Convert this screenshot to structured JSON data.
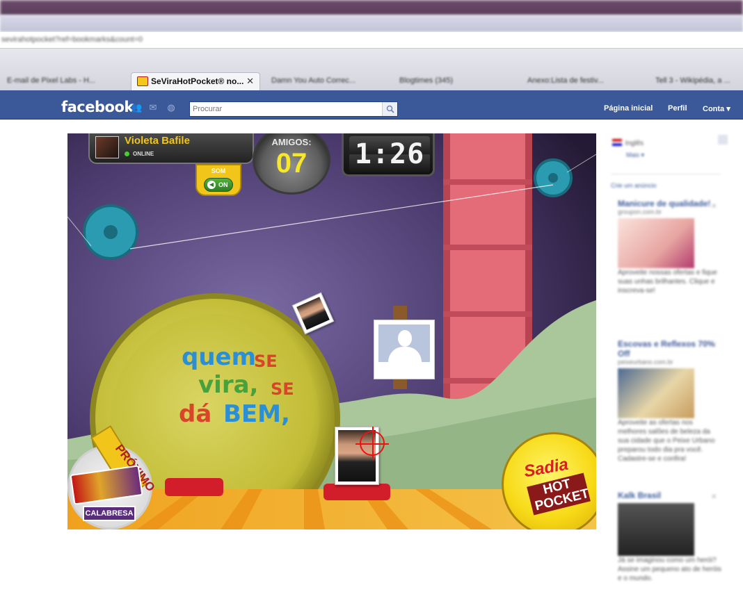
{
  "browser": {
    "address": "sevirahotpocket?ref=bookmarks&count=0",
    "tabs": [
      {
        "label": "E-mail de Pixel Labs - H..."
      },
      {
        "label": "SeViraHotPocket® no...",
        "active": true
      },
      {
        "label": "Damn You Auto Correc..."
      },
      {
        "label": "Blogtimes (345)"
      },
      {
        "label": "Anexo:Lista de festiv..."
      },
      {
        "label": "Tell 3 - Wikipédia, a ..."
      }
    ],
    "close_glyph": "✕"
  },
  "facebook": {
    "logo": "facebook",
    "search_placeholder": "Procurar",
    "nav": {
      "home": "Página inicial",
      "profile": "Perfil",
      "account": "Conta"
    },
    "colors": {
      "bar": "#3b5998"
    }
  },
  "game": {
    "player": {
      "name": "Violeta Bafile",
      "status": "ONLINE"
    },
    "sound": {
      "label": "SOM",
      "state": "ON"
    },
    "friends": {
      "label": "AMIGOS:",
      "count": "07"
    },
    "timer": "1:26",
    "slogan": {
      "line1a": "quem",
      "line1b": "SE",
      "line2a": "vira,",
      "line2b": "SE",
      "line3a": "dá",
      "line3b": "BEM,"
    },
    "next": {
      "label": "PRÓXIMO",
      "flavor": "CALABRESA"
    },
    "brand": {
      "top": "Sadia",
      "main": "HOT POCKET"
    }
  },
  "sidebar": {
    "language": "Inglês",
    "language_link": "Mais ▾",
    "ads_header": "Crie um anúncio",
    "ads": [
      {
        "title": "Manicure de qualidade!",
        "domain": "groupon.com.br",
        "body": "Aproveite nossas ofertas e fique suas unhas brilhantes. Clique e inscreva-se!"
      },
      {
        "title": "Escovas e Reflexos 70% Off",
        "domain": "peixeurbano.com.br",
        "body": "Aproveite as ofertas nos melhores salões de beleza da sua cidade que o Peixe Urbano preparou todo dia pra você. Cadastre-se e confira!"
      },
      {
        "title": "Kalk Brasil",
        "domain": "",
        "body": "Já se imaginou como um herói? Assine um pequeno ato de heróis e o mundo."
      }
    ]
  }
}
